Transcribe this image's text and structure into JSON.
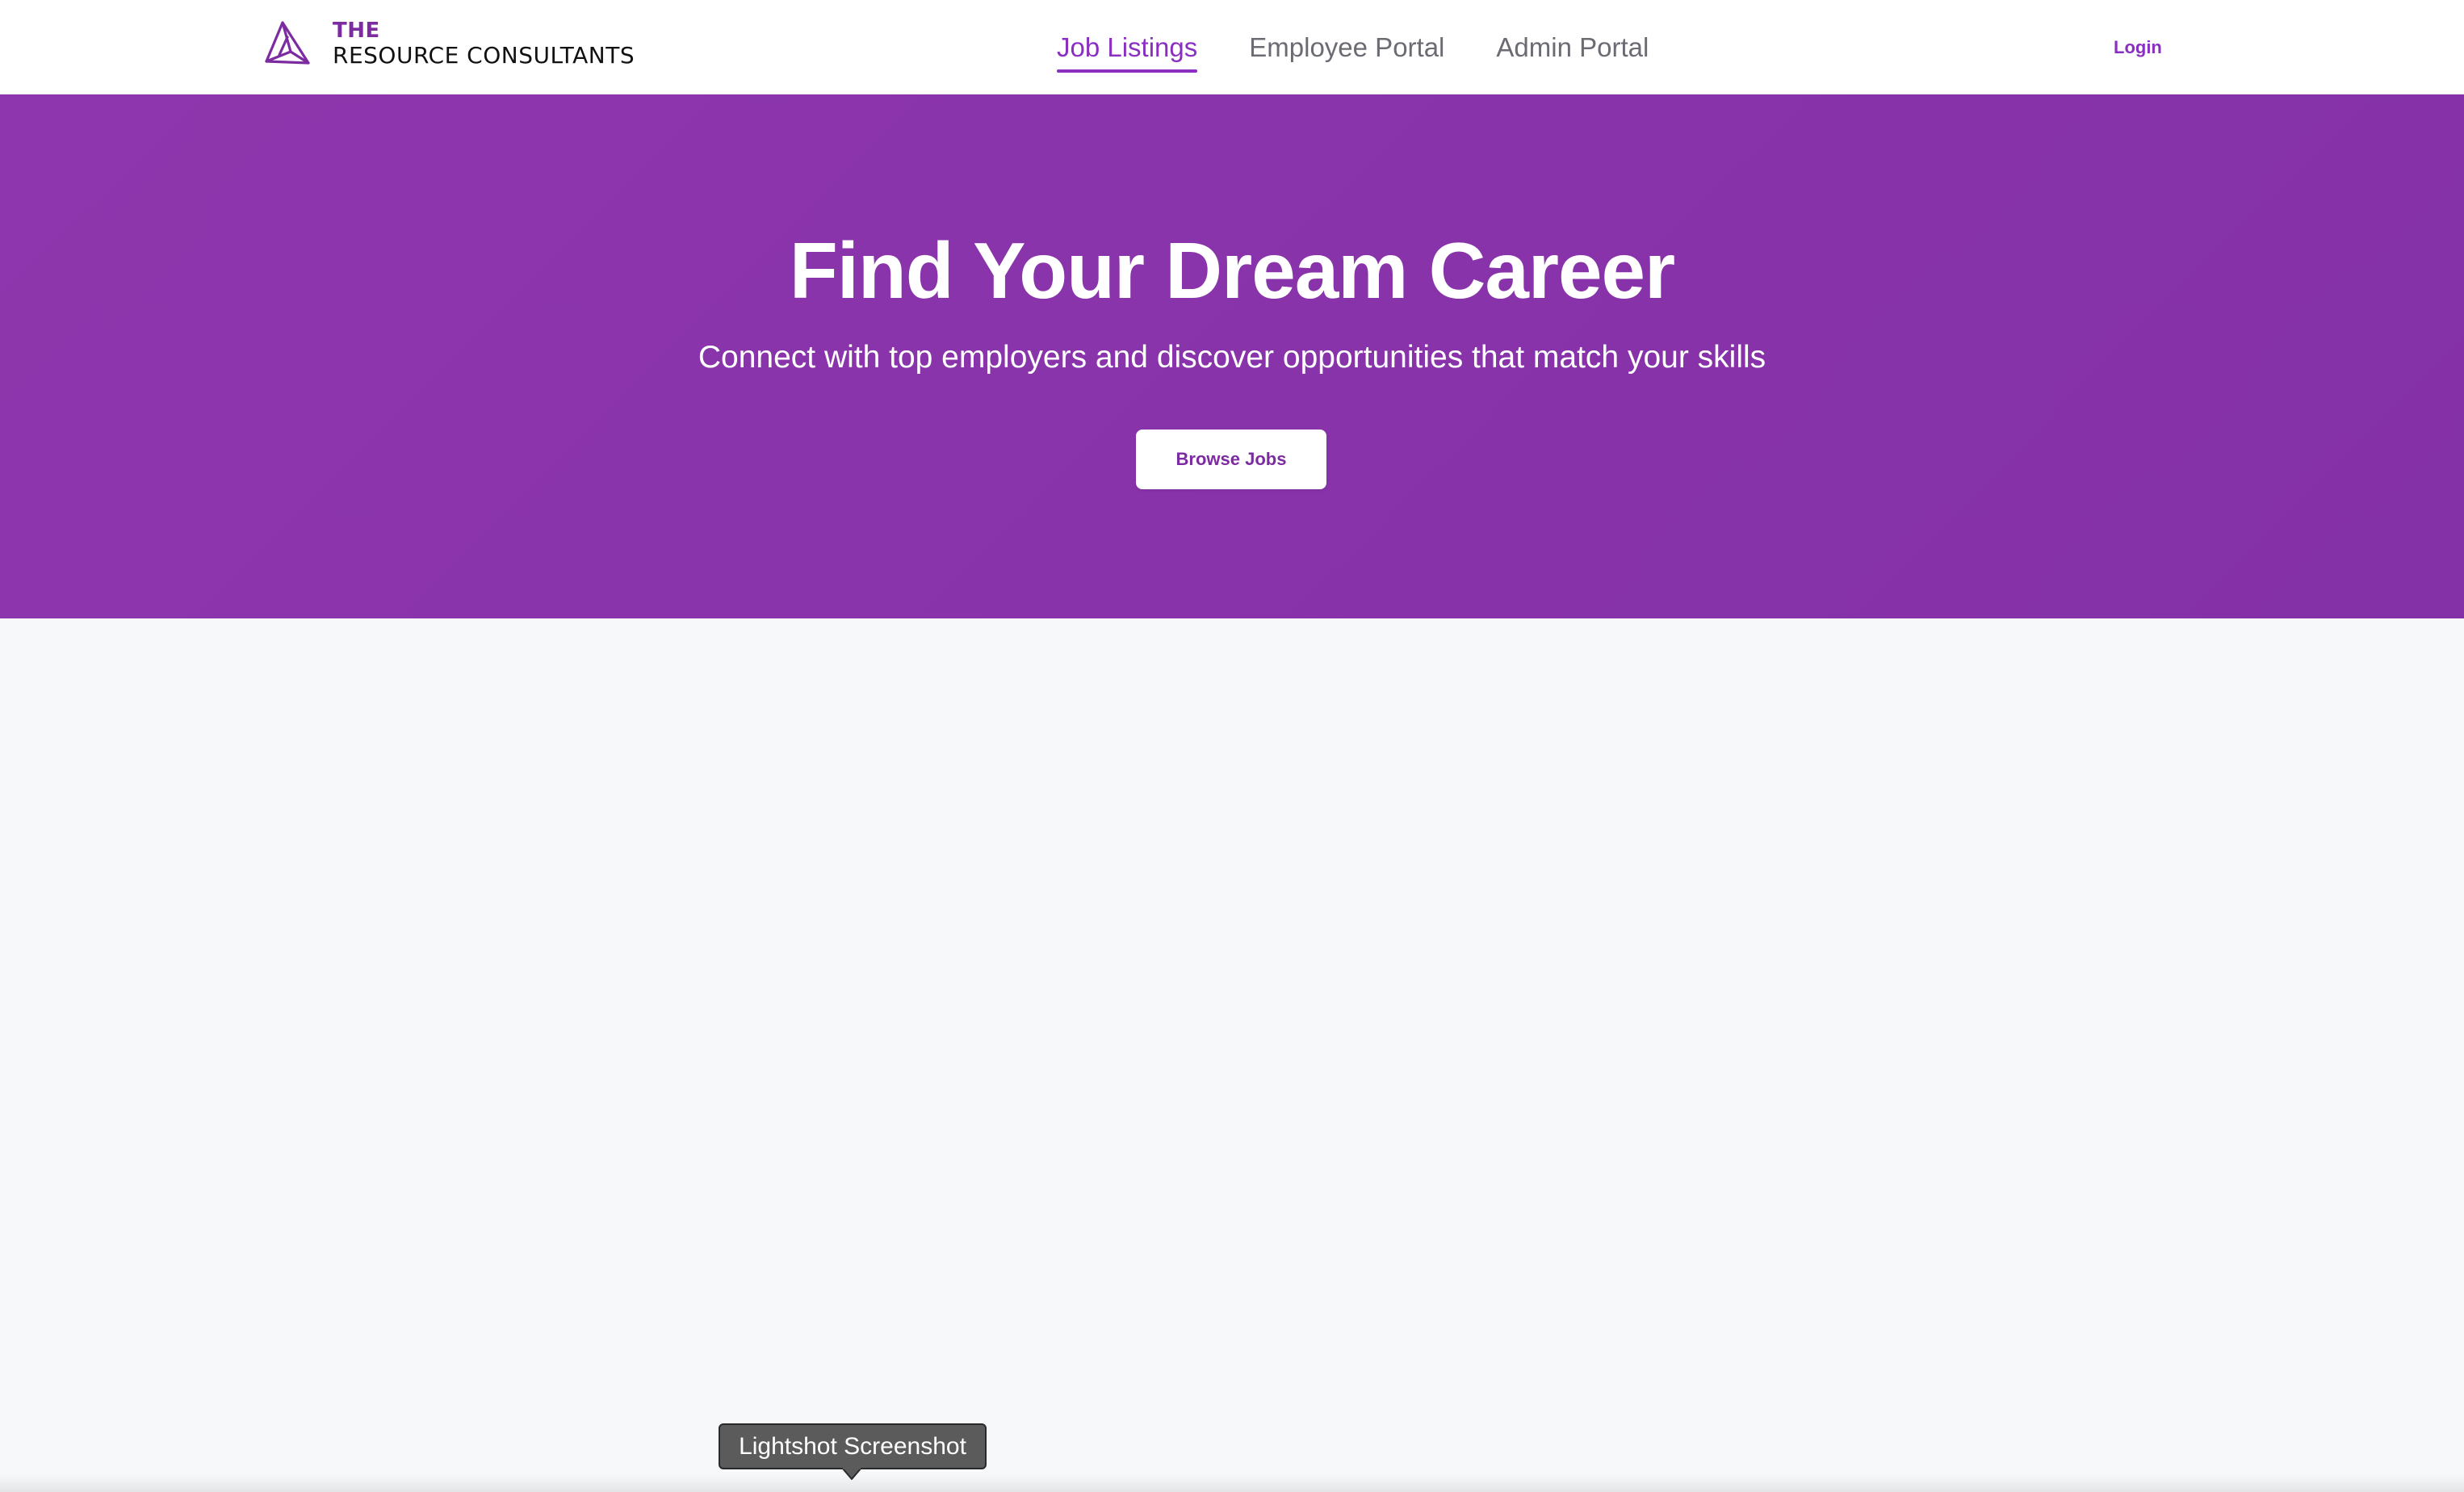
{
  "brand": {
    "line1": "THE",
    "line2": "RESOURCE CONSULTANTS",
    "logo_icon": "pyramid-icon",
    "accent_color": "#8a2fc0"
  },
  "nav": {
    "items": [
      {
        "label": "Job Listings",
        "active": true
      },
      {
        "label": "Employee Portal",
        "active": false
      },
      {
        "label": "Admin Portal",
        "active": false
      }
    ]
  },
  "header": {
    "login_label": "Login"
  },
  "hero": {
    "title": "Find Your Dream Career",
    "subtitle": "Connect with top employers and discover opportunities that match your skills",
    "cta_label": "Browse Jobs",
    "background_color": "#8a33aa"
  },
  "tooltip": {
    "text": "Lightshot Screenshot"
  }
}
